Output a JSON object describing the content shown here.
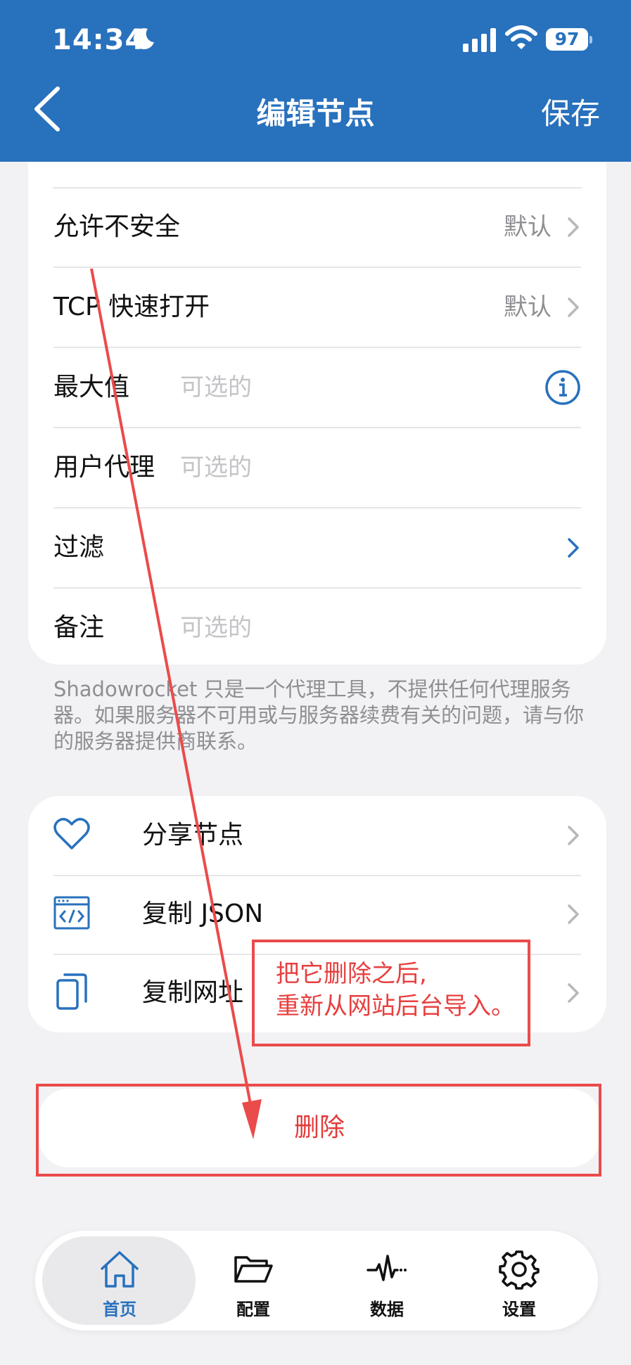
{
  "status_bar": {
    "time": "14:34",
    "battery": "97"
  },
  "nav": {
    "title": "编辑节点",
    "save_label": "保存"
  },
  "settings_rows": [
    {
      "label": "允许不安全",
      "value": "默认"
    },
    {
      "label": "TCP 快速打开",
      "value": "默认"
    },
    {
      "label": "最大值",
      "placeholder": "可选的"
    },
    {
      "label": "用户代理",
      "placeholder": "可选的"
    },
    {
      "label": "过滤"
    },
    {
      "label": "备注",
      "placeholder": "可选的"
    }
  ],
  "footnote": "Shadowrocket 只是一个代理工具，不提供任何代理服务器。如果服务器不可用或与服务器续费有关的问题，请与你的服务器提供商联系。",
  "actions": [
    {
      "label": "分享节点",
      "icon": "heart-icon"
    },
    {
      "label": "复制 JSON",
      "icon": "code-window-icon"
    },
    {
      "label": "复制网址",
      "icon": "copy-icon"
    }
  ],
  "delete_label": "删除",
  "annotation": {
    "line1": "把它删除之后,",
    "line2": "重新从网站后台导入。"
  },
  "tabs": [
    {
      "label": "首页",
      "icon": "home-icon",
      "active": true
    },
    {
      "label": "配置",
      "icon": "folder-icon",
      "active": false
    },
    {
      "label": "数据",
      "icon": "activity-icon",
      "active": false
    },
    {
      "label": "设置",
      "icon": "gear-icon",
      "active": false
    }
  ],
  "colors": {
    "brand": "#2871bd",
    "annotation_red": "#ea4b4b",
    "delete_red": "#e23b3b"
  }
}
